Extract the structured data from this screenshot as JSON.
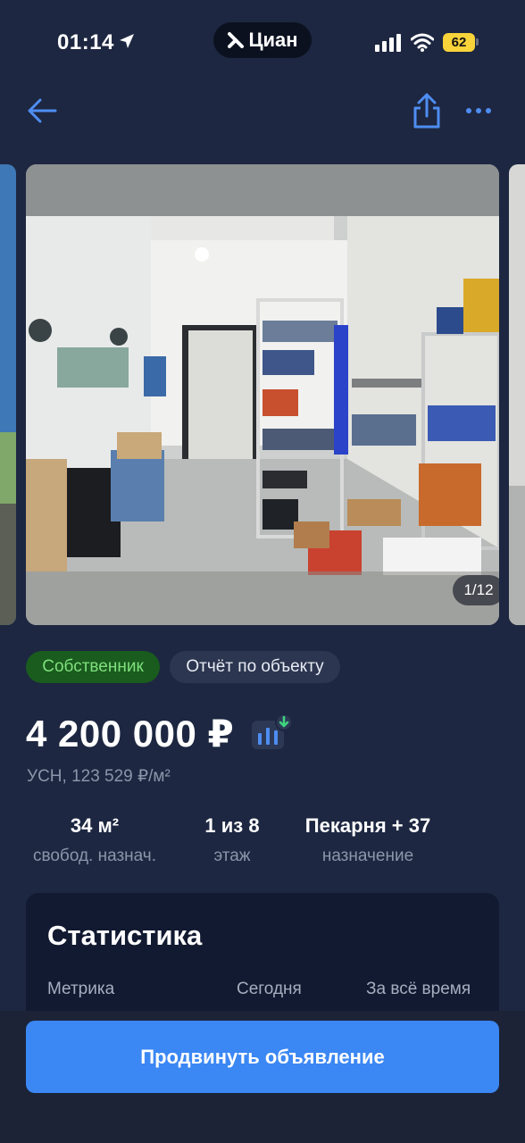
{
  "status_bar": {
    "time": "01:14",
    "app_name": "Циан",
    "battery": "62"
  },
  "gallery": {
    "counter": "1/12"
  },
  "tags": {
    "owner": "Собственник",
    "report": "Отчёт по объекту"
  },
  "price": {
    "value": "4 200 000 ₽",
    "subtitle": "УСН, 123 529 ₽/м²"
  },
  "facts": [
    {
      "value": "34 м²",
      "label": "свобод. назнач."
    },
    {
      "value": "1 из 8",
      "label": "этаж"
    },
    {
      "value": "Пекарня + 37",
      "label": "назначение"
    }
  ],
  "stats": {
    "title": "Статистика",
    "columns": [
      "Метрика",
      "Сегодня",
      "За всё время"
    ]
  },
  "actions": {
    "promote": "Продвинуть объявление"
  },
  "colors": {
    "background": "#1d2741",
    "accent": "#3b87f4",
    "owner_tag_bg": "#1a5b1e",
    "owner_tag_text": "#7ee07c",
    "battery": "#f8d33a"
  },
  "icons": [
    "location-arrow-icon",
    "cian-logo-icon",
    "signal-icon",
    "wifi-icon",
    "back-arrow-icon",
    "share-icon",
    "more-dots-icon",
    "price-chart-icon"
  ]
}
